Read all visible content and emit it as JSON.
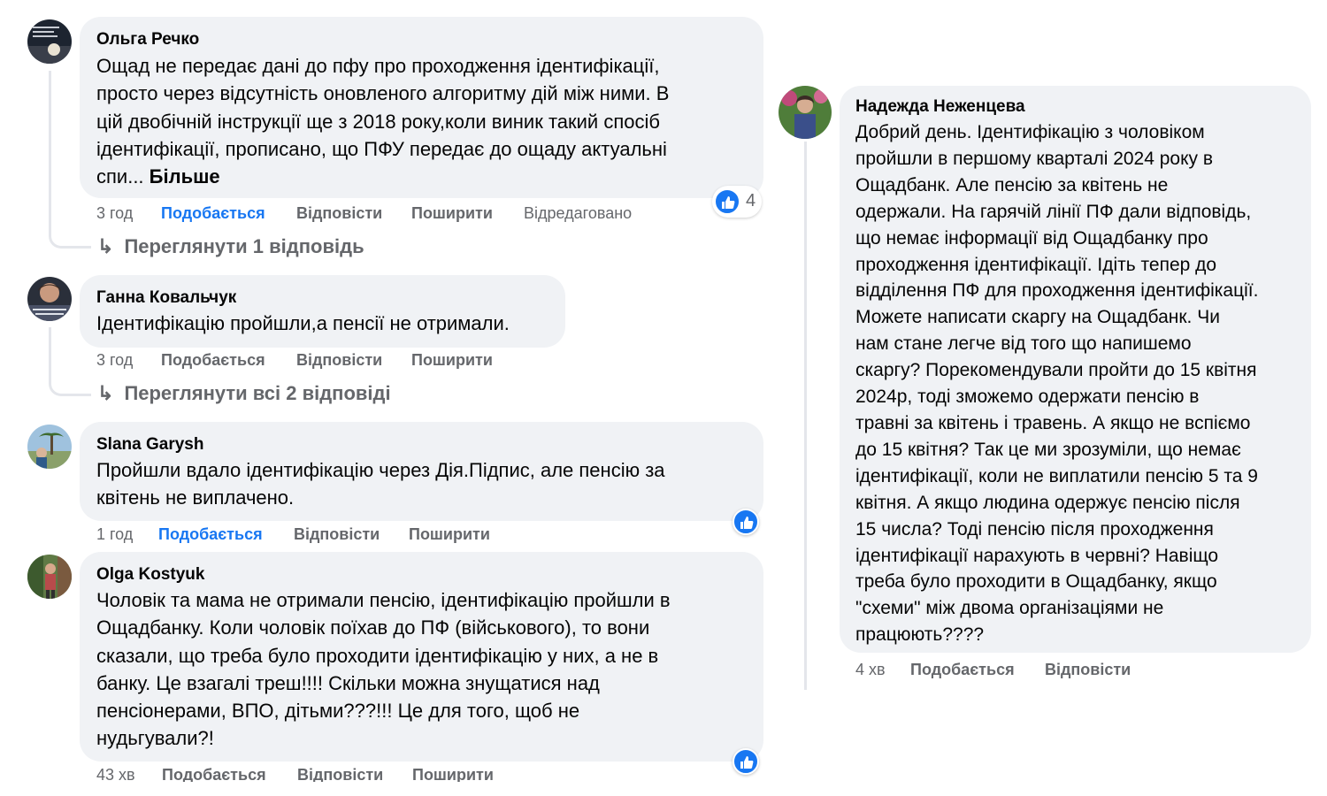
{
  "comments": [
    {
      "author": "Ольга Речко",
      "lines": [
        "Ощад не передає дані до пфу про проходження ідентифікації,",
        "просто через відсутність оновленого алгоритму дій між ними. В",
        "цій двобічній інструкції ще з 2018 року,коли виник такий спосіб",
        "ідентифікації, прописано, що ПФУ передає до ощаду актуальні"
      ],
      "last_line": "спи...",
      "more_label": "Більше",
      "time": "3 год",
      "like_label": "Подобається",
      "reply_label": "Відповісти",
      "share_label": "Поширити",
      "edited_label": "Відредаговано",
      "reactions_count": "4",
      "view_replies": "Переглянути 1 відповідь"
    },
    {
      "author": "Ганна Ковальчук",
      "lines": [
        "Ідентифікацію пройшли,а пенсії не отримали."
      ],
      "time": "3 год",
      "like_label": "Подобається",
      "reply_label": "Відповісти",
      "share_label": "Поширити",
      "view_replies": "Переглянути всі 2 відповіді"
    },
    {
      "author": "Slana Garysh",
      "lines": [
        "Пройшли вдало ідентифікацію через Дія.Підпис, але пенсію за",
        "квітень не виплачено."
      ],
      "time": "1 год",
      "like_label": "Подобається",
      "reply_label": "Відповісти",
      "share_label": "Поширити"
    },
    {
      "author": "Olga Kostyuk",
      "lines": [
        "Чоловік та мама не отримали пенсію, ідентифікацію пройшли в",
        "Ощадбанку. Коли чоловік поїхав до ПФ (військового), то вони",
        "сказали, що треба було проходити ідентифікацію у них, а не в",
        "банку. Це взагалі треш!!!! Скільки можна знущатися над",
        "пенсіонерами, ВПО, дітьми???!!! Це для того, щоб не",
        "нудьгували?!"
      ],
      "time": "43 хв",
      "like_label": "Подобається",
      "reply_label": "Відповісти",
      "share_label": "Поширити"
    },
    {
      "author": "Надежда Неженцева",
      "lines": [
        "Добрий день. Ідентифікацію з чоловіком",
        "пройшли в першому кварталі 2024 року в",
        "Ощадбанк. Але пенсію за квітень не",
        "одержали. На гарячій лінії ПФ дали відповідь,",
        "що немає інформації від Ощадбанку про",
        "проходження ідентифікації. Ідіть тепер до",
        "відділення ПФ для проходження ідентифікації.",
        "Можете написати скаргу на Ощадбанк. Чи",
        "нам стане легче від того що напишемо",
        "скаргу? Порекомендували пройти до 15 квітня",
        "2024р, тоді зможемо одержати пенсію в",
        "травні за квітень і травень. А якщо не вспіємо",
        "до 15 квітня? Так це ми зрозуміли, що немає",
        "ідентифікації, коли не виплатили пенсію 5 та 9",
        "квітня. А якщо людина одержує пенсію після",
        "15 числа? Тоді пенсію після проходження",
        "ідентифікації нарахують в червні? Навіщо",
        "треба було проходити в Ощадбанку, якщо",
        "\"схеми\" між двома організаціями не",
        "працюють????"
      ],
      "time": "4 хв",
      "like_label": "Подобається",
      "reply_label": "Відповісти"
    }
  ],
  "colors": {
    "bubble": "#f0f2f5",
    "secondary_text": "#65676b",
    "liked": "#1877f2",
    "thread": "#e4e6eb"
  },
  "icons": {
    "reply_arrow": "↳",
    "reaction": "like-thumb-icon"
  }
}
